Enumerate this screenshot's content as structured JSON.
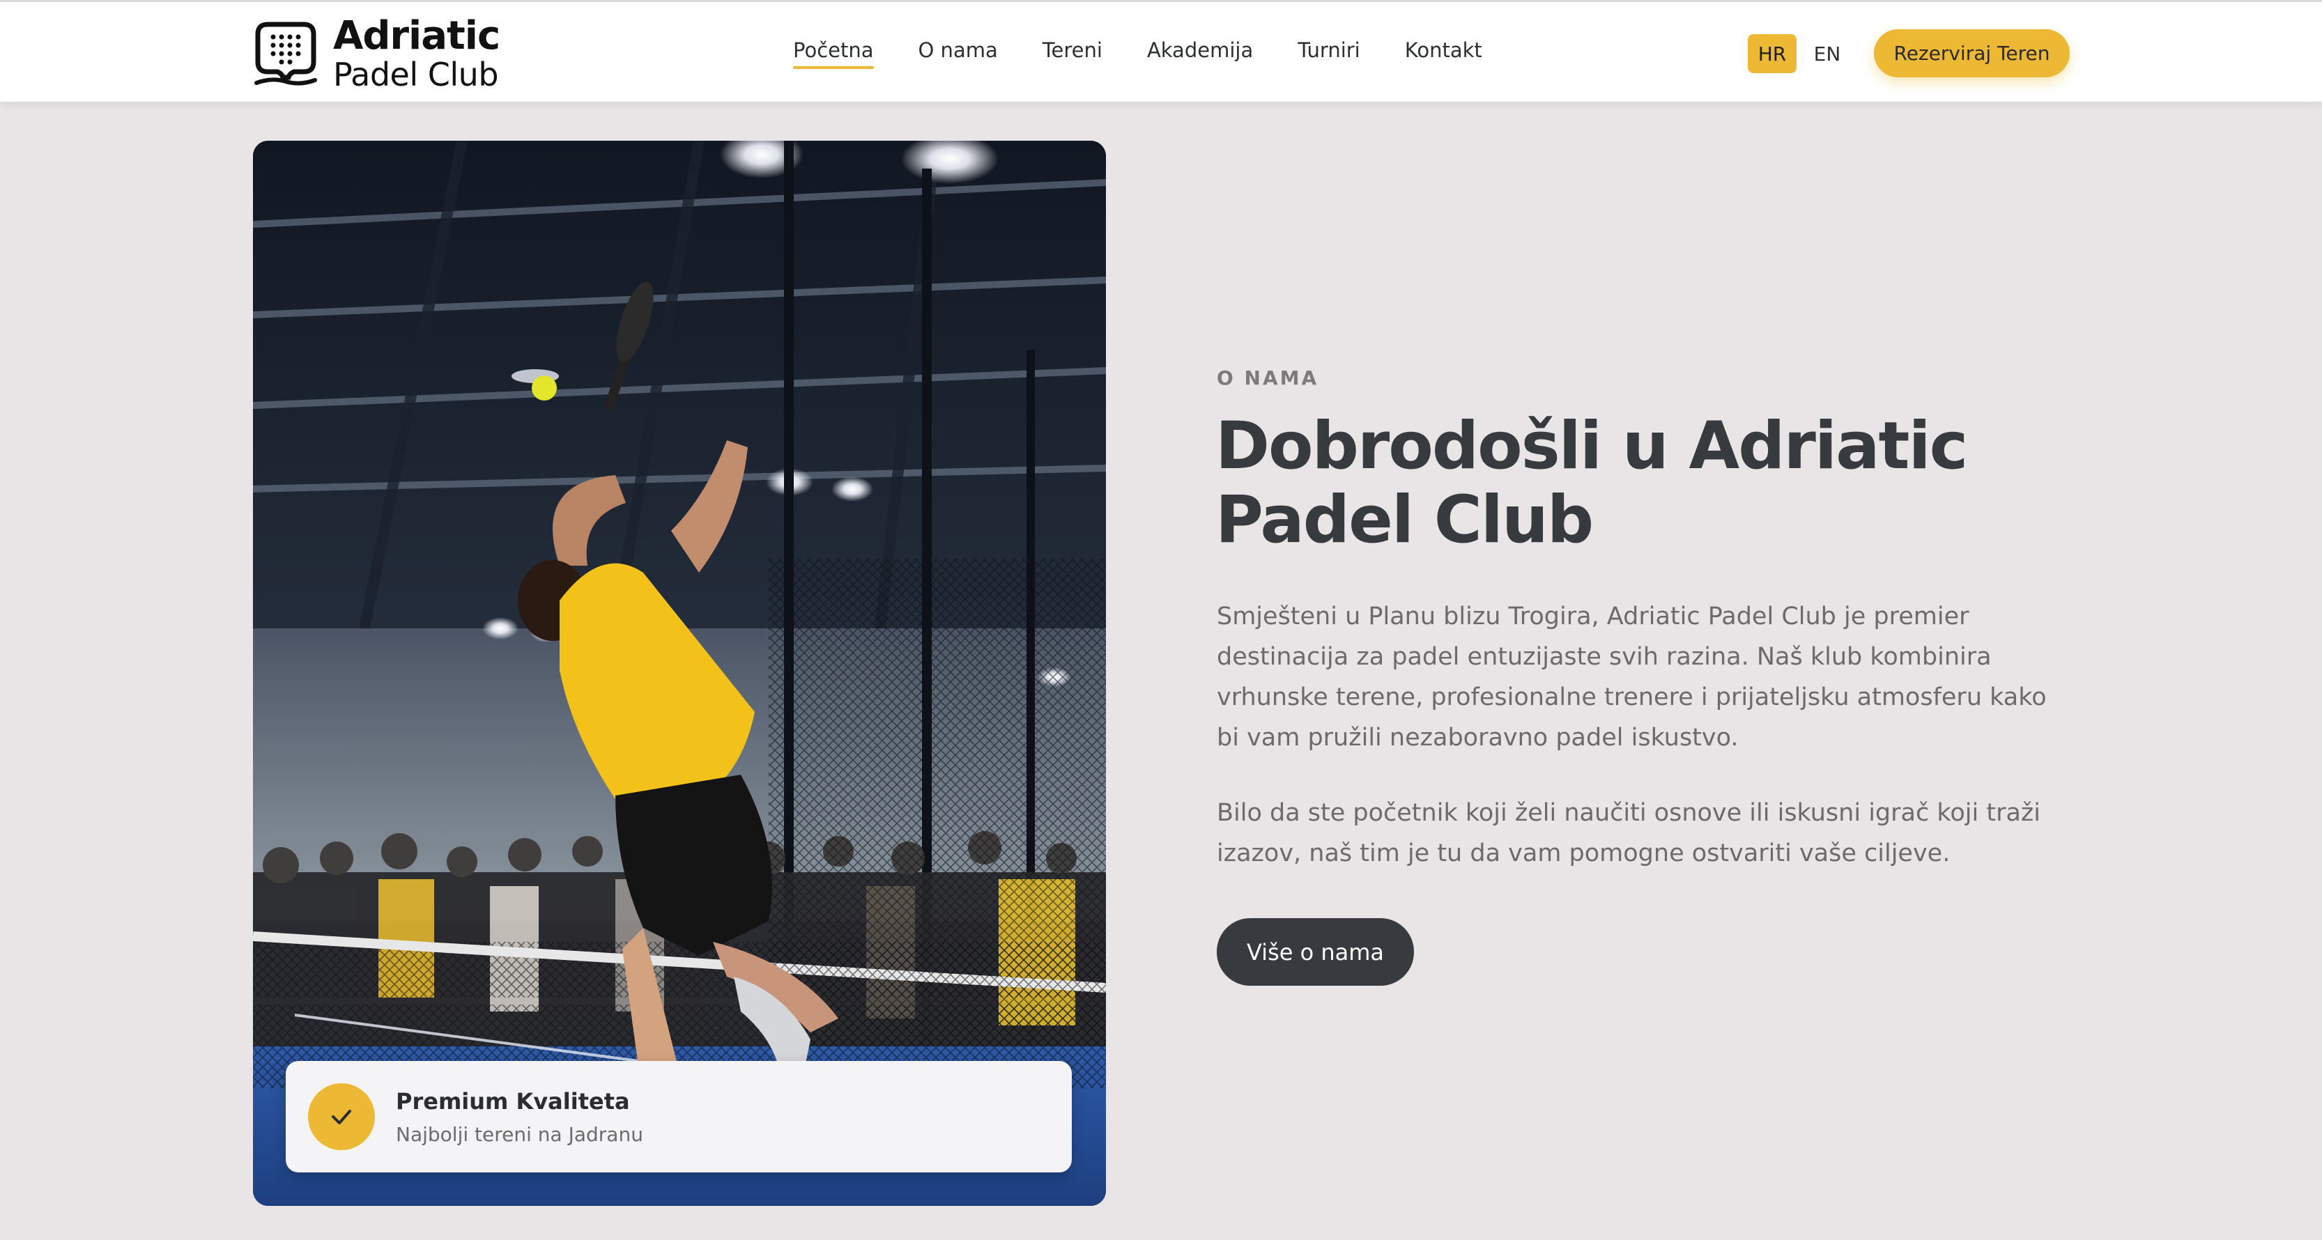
{
  "brand": {
    "name_line1": "Adriatic",
    "name_line2": "Padel Club"
  },
  "nav": {
    "items": [
      {
        "label": "Početna",
        "active": true
      },
      {
        "label": "O nama",
        "active": false
      },
      {
        "label": "Tereni",
        "active": false
      },
      {
        "label": "Akademija",
        "active": false
      },
      {
        "label": "Turniri",
        "active": false
      },
      {
        "label": "Kontakt",
        "active": false
      }
    ]
  },
  "language": {
    "options": [
      "HR",
      "EN"
    ],
    "selected": "HR"
  },
  "header": {
    "cta_label": "Rezerviraj Teren"
  },
  "about": {
    "kicker": "O NAMA",
    "title": "Dobrodošli u Adriatic Padel Club",
    "paragraph1": "Smješteni u Planu blizu Trogira, Adriatic Padel Club je premier destinacija za padel entuzijaste svih razina. Naš klub kombinira vrhunske terene, profesionalne trenere i prijateljsku atmosferu kako bi vam pružili nezaboravno padel iskustvo.",
    "paragraph2": "Bilo da ste početnik koji želi naučiti osnove ili iskusni igrač koji traži izazov, naš tim je tu da vam pomogne ostvariti vaše ciljeve.",
    "button_label": "Više o nama"
  },
  "badge": {
    "title": "Premium Kvaliteta",
    "subtitle": "Najbolji tereni na Jadranu",
    "icon": "check-icon"
  },
  "colors": {
    "accent": "#edb935",
    "dark": "#373a3e",
    "background": "#e9e5e6"
  }
}
